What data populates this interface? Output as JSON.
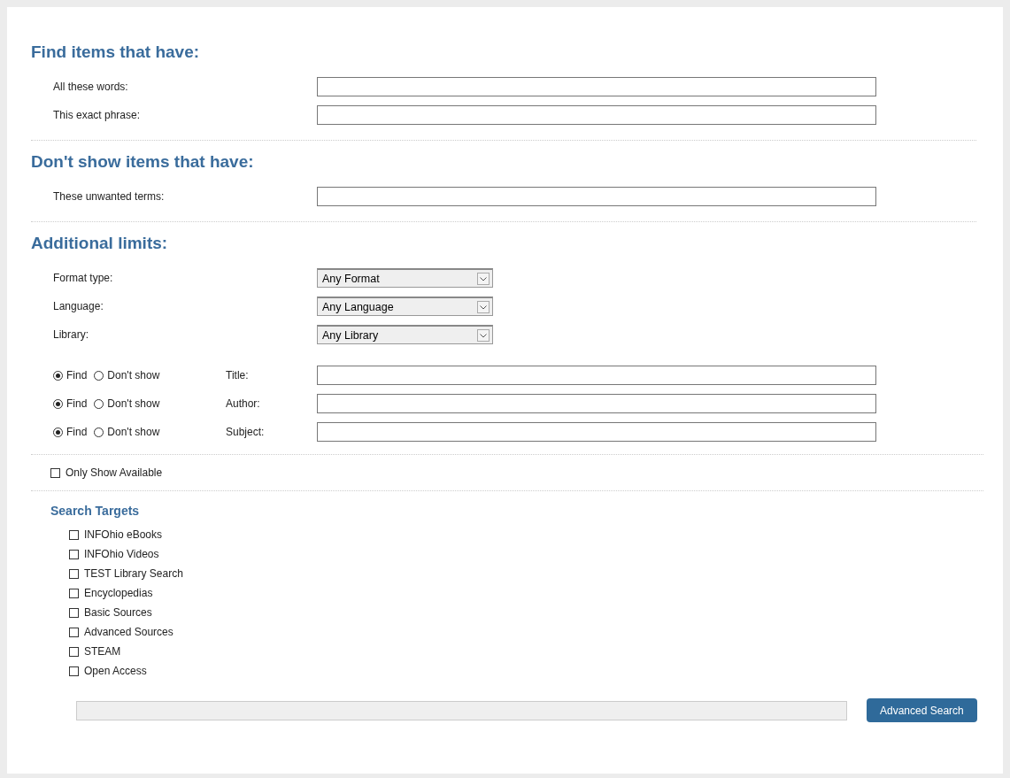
{
  "find_section": {
    "heading": "Find items that have:",
    "fields": [
      {
        "label": "All these words:"
      },
      {
        "label": "This exact phrase:"
      }
    ]
  },
  "exclude_section": {
    "heading": "Don't show items that have:",
    "fields": [
      {
        "label": "These unwanted terms:"
      }
    ]
  },
  "limits_section": {
    "heading": "Additional limits:",
    "dropdowns": [
      {
        "label": "Format type:",
        "value": "Any Format"
      },
      {
        "label": "Language:",
        "value": "Any Language"
      },
      {
        "label": "Library:",
        "value": "Any Library"
      }
    ],
    "field_rows": [
      {
        "options": [
          {
            "label": "Find",
            "selected": true
          },
          {
            "label": "Don't show",
            "selected": false
          }
        ],
        "label": "Title:"
      },
      {
        "options": [
          {
            "label": "Find",
            "selected": true
          },
          {
            "label": "Don't show",
            "selected": false
          }
        ],
        "label": "Author:"
      },
      {
        "options": [
          {
            "label": "Find",
            "selected": true
          },
          {
            "label": "Don't show",
            "selected": false
          }
        ],
        "label": "Subject:"
      }
    ]
  },
  "only_available": {
    "label": "Only Show Available",
    "checked": false
  },
  "search_targets": {
    "heading": "Search Targets",
    "items": [
      {
        "label": "INFOhio eBooks",
        "checked": false
      },
      {
        "label": "INFOhio Videos",
        "checked": false
      },
      {
        "label": "TEST Library Search",
        "checked": false
      },
      {
        "label": "Encyclopedias",
        "checked": false
      },
      {
        "label": "Basic Sources",
        "checked": false
      },
      {
        "label": "Advanced Sources",
        "checked": false
      },
      {
        "label": "STEAM",
        "checked": false
      },
      {
        "label": "Open Access",
        "checked": false
      }
    ]
  },
  "search_button": {
    "label": "Advanced Search"
  }
}
